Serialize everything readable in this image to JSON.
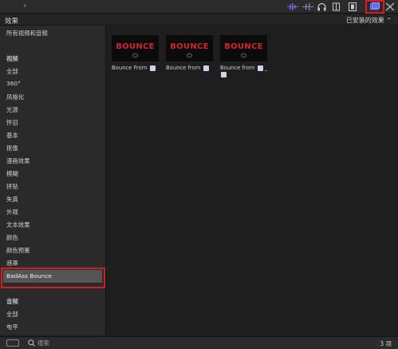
{
  "browser": {
    "title": "效果",
    "filter_label": "已安装的效果"
  },
  "sidebar": {
    "items": [
      {
        "label": "所有视频和音频",
        "header": false
      },
      {
        "label": "视频",
        "header": true
      },
      {
        "label": "全部",
        "header": false
      },
      {
        "label": "360°",
        "header": false
      },
      {
        "label": "风格化",
        "header": false
      },
      {
        "label": "光源",
        "header": false
      },
      {
        "label": "怀旧",
        "header": false
      },
      {
        "label": "基本",
        "header": false
      },
      {
        "label": "抠像",
        "header": false
      },
      {
        "label": "漫画效果",
        "header": false
      },
      {
        "label": "模糊",
        "header": false
      },
      {
        "label": "拼贴",
        "header": false
      },
      {
        "label": "失真",
        "header": false
      },
      {
        "label": "外观",
        "header": false
      },
      {
        "label": "文本效果",
        "header": false
      },
      {
        "label": "颜色",
        "header": false
      },
      {
        "label": "颜色预置",
        "header": false
      },
      {
        "label": "遮罩",
        "header": false
      },
      {
        "label": "BadAss Bounce",
        "header": false,
        "selected": true
      },
      {
        "label": "音频",
        "header": true
      },
      {
        "label": "全部",
        "header": false
      },
      {
        "label": "电平",
        "header": false
      }
    ]
  },
  "effects": [
    {
      "thumb_text": "BOUNCE",
      "label": "Bounce From",
      "icon": "left-right-arrows-icon"
    },
    {
      "thumb_text": "BOUNCE",
      "label": "Bounce from",
      "icon": "up-down-arrows-icon"
    },
    {
      "thumb_text": "BOUNCE",
      "label": "Bounce from",
      "icon": "diagonal-arrow-icon",
      "extra": "_"
    }
  ],
  "footer": {
    "search_placeholder": "搜索",
    "count": "3 项"
  },
  "colors": {
    "accent": "#6a6af0",
    "highlight_box": "#d41e23",
    "thumb_text": "#d0262f"
  }
}
